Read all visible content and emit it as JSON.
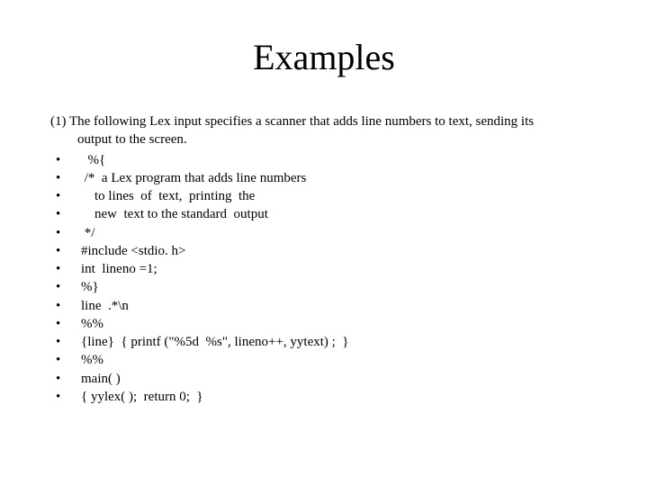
{
  "title": "Examples",
  "intro_line1": "(1) The following Lex input specifies a scanner that adds line numbers to text, sending its",
  "intro_line2": "output to the screen.",
  "bullets": [
    "  %{",
    " /*  a Lex program that adds line numbers",
    "    to lines  of  text,  printing  the",
    "    new  text to the standard  output",
    " */",
    "#include <stdio. h>",
    "int  lineno =1;",
    "%}",
    "line  .*\\n",
    "%%",
    "{line}  { printf (\"%5d  %s\", lineno++, yytext) ;  }",
    "%%",
    "main( )",
    "{ yylex( );  return 0;  }"
  ]
}
